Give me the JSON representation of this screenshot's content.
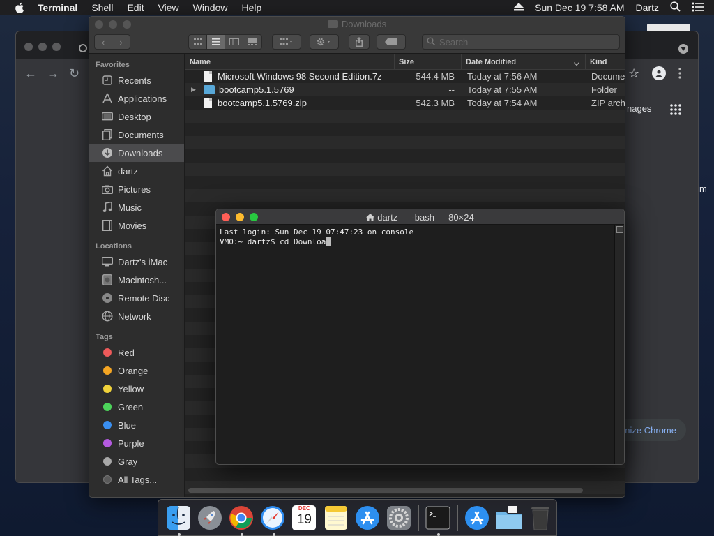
{
  "menubar": {
    "app_name": "Terminal",
    "menus": [
      "Shell",
      "Edit",
      "View",
      "Window",
      "Help"
    ],
    "clock": "Sun Dec 19  7:58 AM",
    "user": "Dartz"
  },
  "chrome": {
    "right_text_manages": "nages",
    "right_text_m": "m",
    "customize_label": "nize Chrome"
  },
  "finder": {
    "title": "Downloads",
    "search_placeholder": "Search",
    "sidebar": {
      "favorites_header": "Favorites",
      "favorites": [
        "Recents",
        "Applications",
        "Desktop",
        "Documents",
        "Downloads",
        "dartz",
        "Pictures",
        "Music",
        "Movies"
      ],
      "locations_header": "Locations",
      "locations": [
        "Dartz's iMac",
        "Macintosh...",
        "Remote Disc",
        "Network"
      ],
      "tags_header": "Tags",
      "tags": [
        {
          "label": "Red",
          "color": "#ee5a5a"
        },
        {
          "label": "Orange",
          "color": "#f5a623"
        },
        {
          "label": "Yellow",
          "color": "#f0d23a"
        },
        {
          "label": "Green",
          "color": "#4cd35a"
        },
        {
          "label": "Blue",
          "color": "#3a8ff0"
        },
        {
          "label": "Purple",
          "color": "#b45ae0"
        },
        {
          "label": "Gray",
          "color": "#a8a8a8"
        },
        {
          "label": "All Tags...",
          "color": "#6a6a6a"
        }
      ]
    },
    "columns": {
      "name": "Name",
      "size": "Size",
      "date": "Date Modified",
      "kind": "Kind"
    },
    "files": [
      {
        "name": "Microsoft Windows 98 Second Edition.7z",
        "size": "544.4 MB",
        "date": "Today at 7:56 AM",
        "kind": "Docume"
      },
      {
        "name": "bootcamp5.1.5769",
        "size": "--",
        "date": "Today at 7:55 AM",
        "kind": "Folder"
      },
      {
        "name": "bootcamp5.1.5769.zip",
        "size": "542.3 MB",
        "date": "Today at 7:54 AM",
        "kind": "ZIP arch"
      }
    ]
  },
  "terminal": {
    "title": "dartz — -bash — 80×24",
    "line1": "Last login: Sun Dec 19 07:47:23 on console",
    "prompt": "VM0:~ dartz$ cd Downloa"
  },
  "dock": {
    "calendar_month": "DEC",
    "calendar_day": "19"
  }
}
